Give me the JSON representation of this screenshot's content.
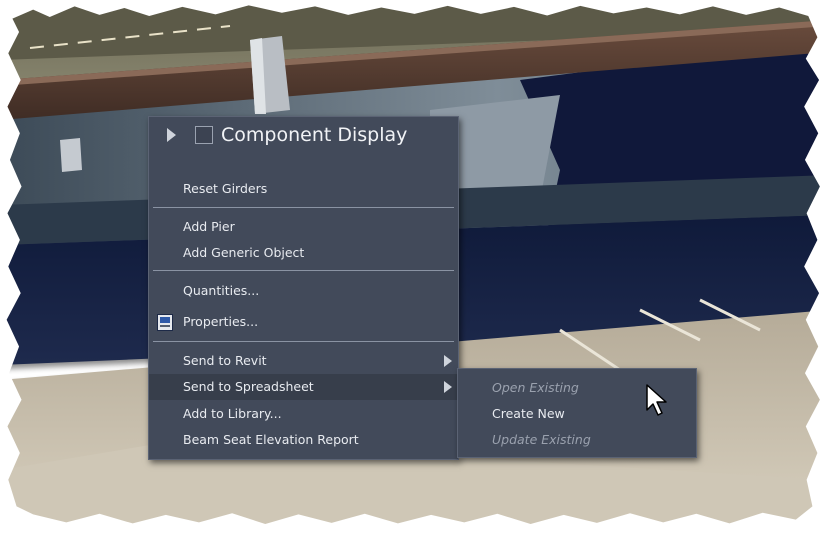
{
  "context_menu": {
    "title": "Component Display",
    "items": [
      {
        "label": "Reset Girders"
      },
      {
        "label": "Add Pier"
      },
      {
        "label": "Add Generic Object"
      },
      {
        "label": "Quantities..."
      },
      {
        "label": "Properties..."
      },
      {
        "label": "Send to Revit"
      },
      {
        "label": "Send to Spreadsheet"
      },
      {
        "label": "Add to Library..."
      },
      {
        "label": "Beam Seat Elevation Report"
      }
    ]
  },
  "submenu": {
    "items": [
      {
        "label": "Open Existing",
        "enabled": false
      },
      {
        "label": "Create New",
        "enabled": true
      },
      {
        "label": "Update Existing",
        "enabled": false
      }
    ]
  },
  "colors": {
    "menu_background": "#424a5a",
    "menu_highlight": "#373e4b",
    "menu_text": "#e8ebf0",
    "disabled_text": "#9aa1ae"
  },
  "icons": {
    "title_expand": "triangle-right-icon",
    "title_toggle": "checkbox-icon",
    "properties": "properties-icon",
    "submenu_arrow": "chevron-right-icon",
    "cursor": "mouse-pointer-icon"
  }
}
